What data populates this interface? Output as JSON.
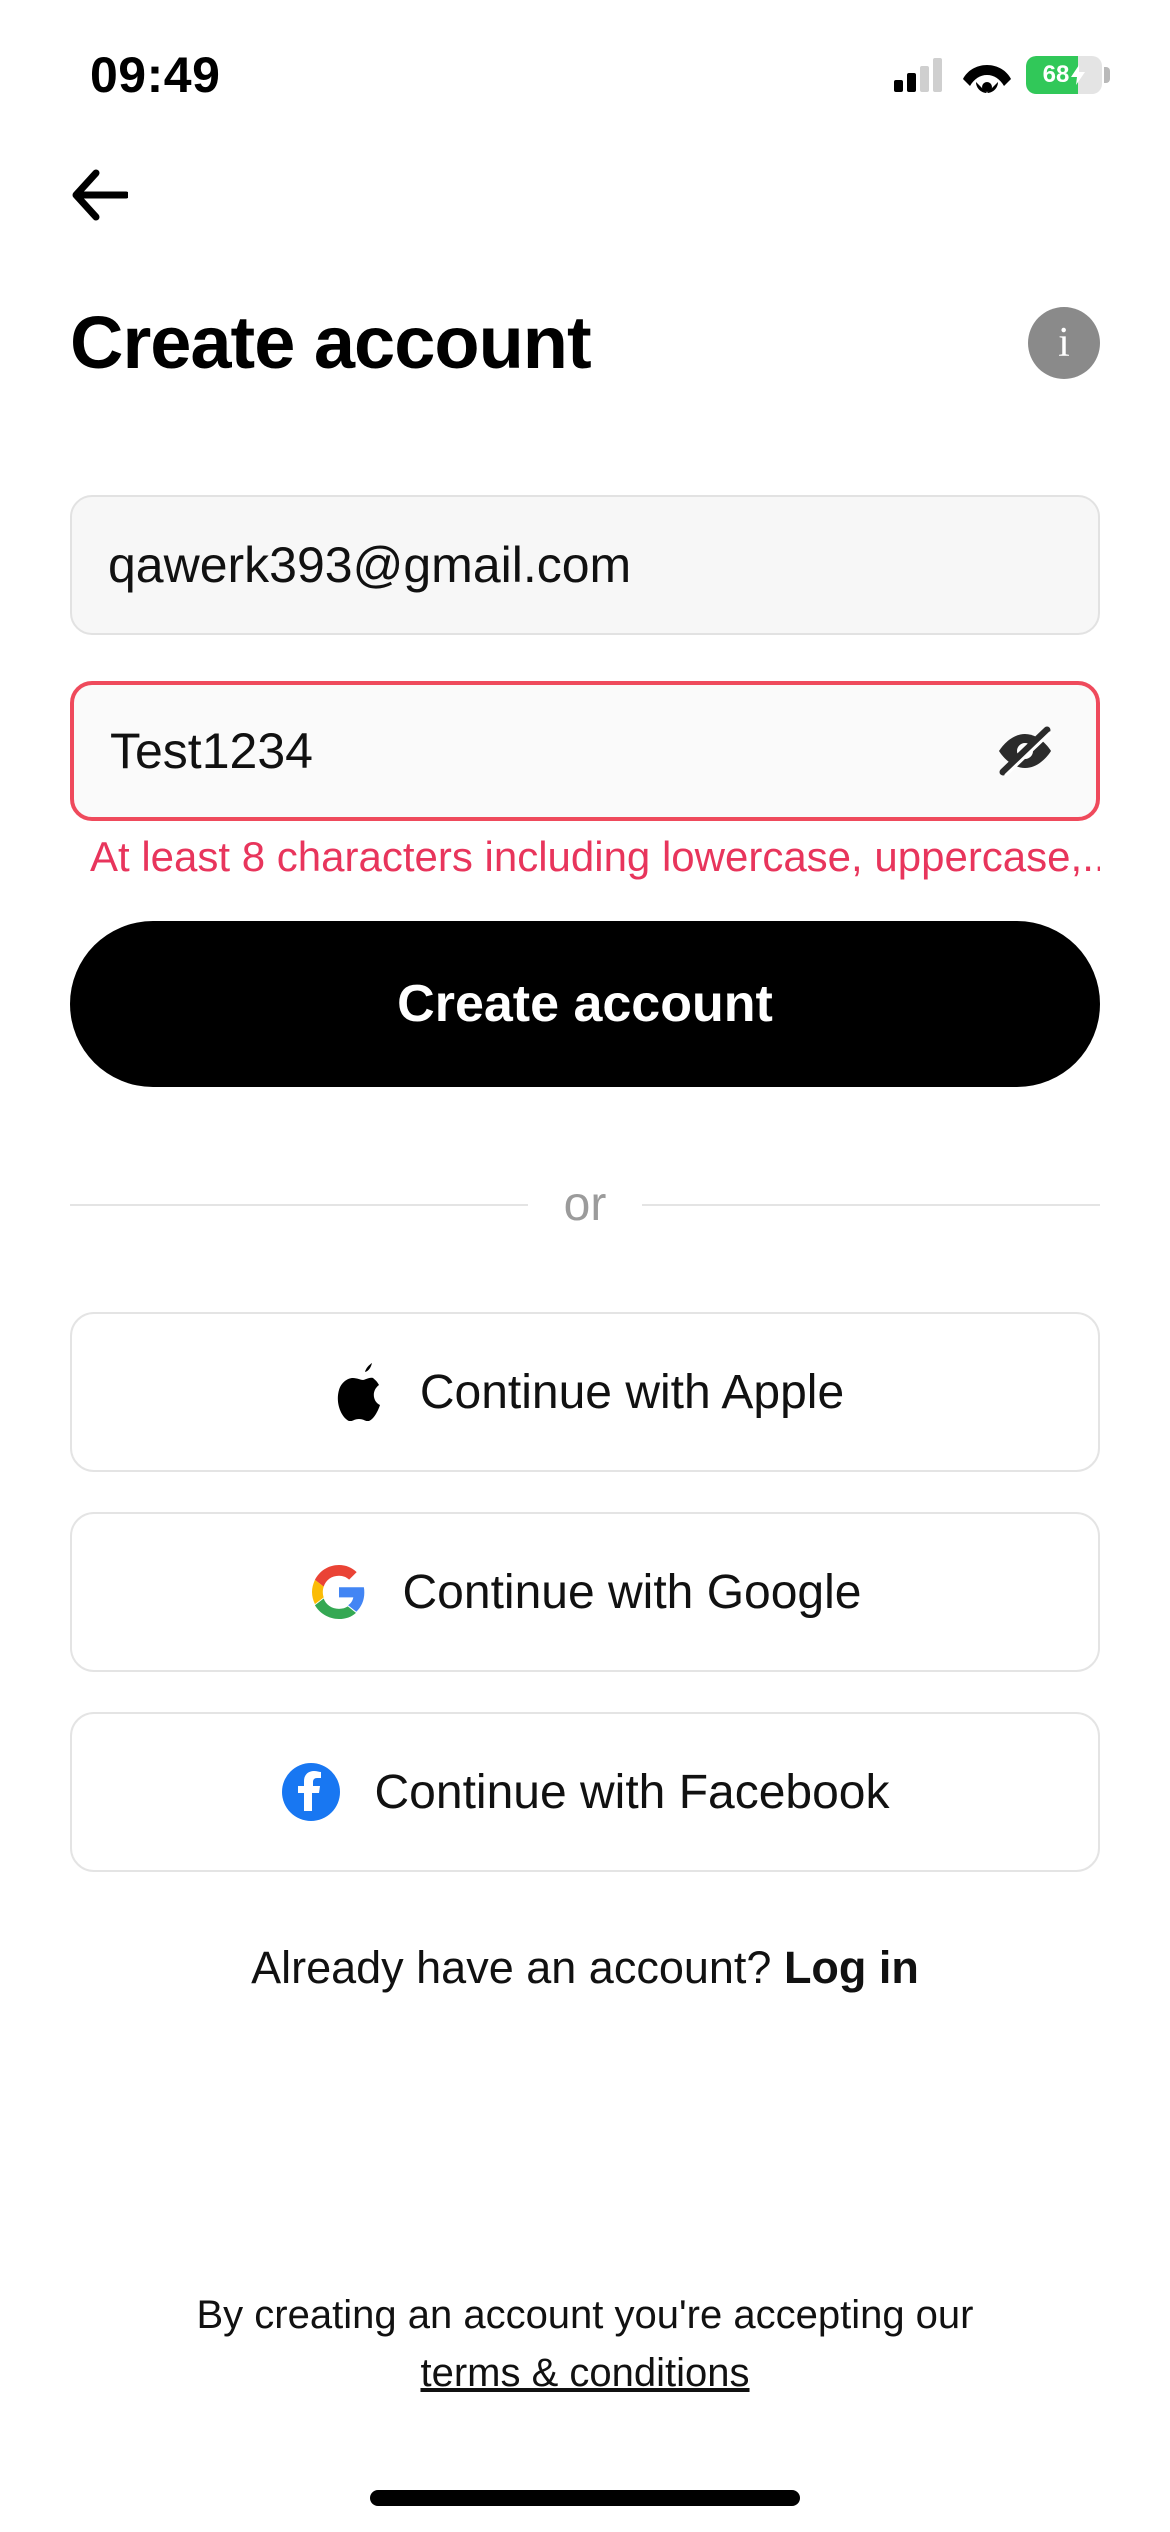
{
  "status": {
    "time": "09:49",
    "battery_percent": "68"
  },
  "header": {
    "title": "Create account"
  },
  "form": {
    "email_value": "qawerk393@gmail.com",
    "password_value": "Test1234",
    "password_error": "At least 8 characters including lowercase, uppercase,...",
    "submit_label": "Create account"
  },
  "divider": {
    "label": "or"
  },
  "social": {
    "apple": "Continue with Apple",
    "google": "Continue with Google",
    "facebook": "Continue with Facebook"
  },
  "login": {
    "prompt": "Already have an account? ",
    "link": "Log in"
  },
  "terms": {
    "line1": "By creating an account you're accepting our",
    "link": "terms & conditions"
  },
  "colors": {
    "error": "#e8355c",
    "battery_fill": "#31c859"
  }
}
